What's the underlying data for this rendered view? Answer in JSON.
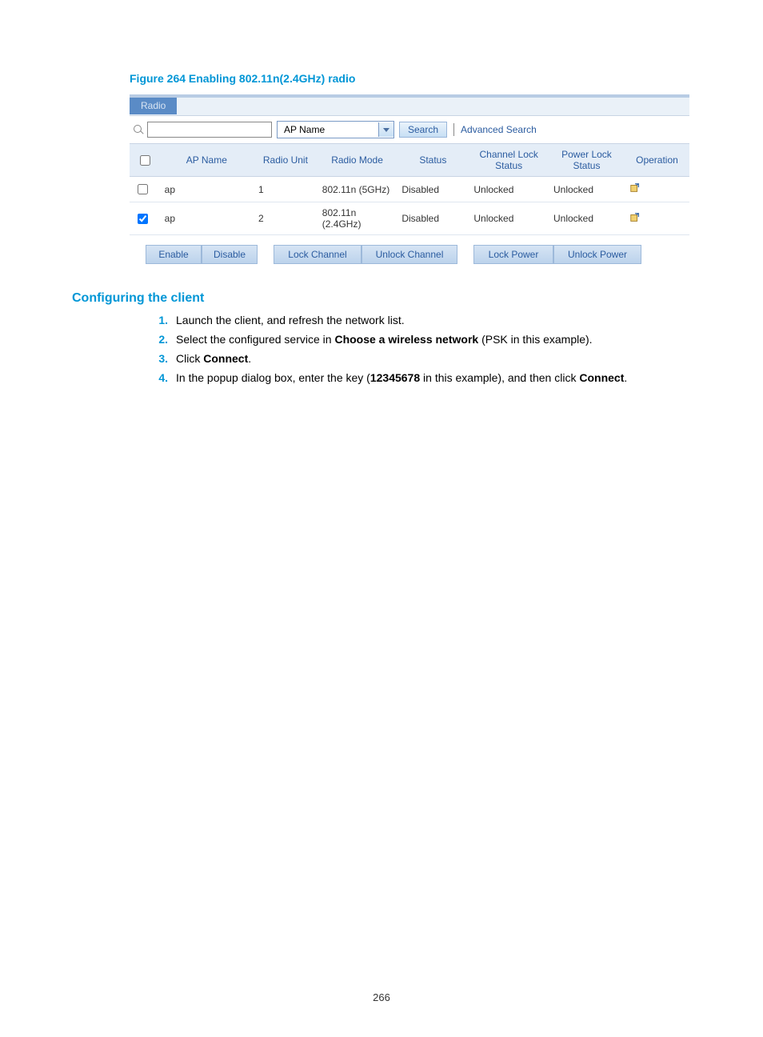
{
  "figure_caption": "Figure 264 Enabling 802.11n(2.4GHz) radio",
  "tab_label": "Radio",
  "search": {
    "input_value": "",
    "dropdown_selected": "AP Name",
    "search_btn": "Search",
    "advanced_link": "Advanced Search"
  },
  "table": {
    "headers": {
      "checkbox": "",
      "ap_name": "AP Name",
      "radio_unit": "Radio Unit",
      "radio_mode": "Radio Mode",
      "status": "Status",
      "channel_lock": "Channel Lock Status",
      "power_lock": "Power Lock Status",
      "operation": "Operation"
    },
    "rows": [
      {
        "checked": false,
        "ap_name": "ap",
        "radio_unit": "1",
        "radio_mode": "802.11n (5GHz)",
        "status": "Disabled",
        "channel_lock": "Unlocked",
        "power_lock": "Unlocked"
      },
      {
        "checked": true,
        "ap_name": "ap",
        "radio_unit": "2",
        "radio_mode": "802.11n (2.4GHz)",
        "status": "Disabled",
        "channel_lock": "Unlocked",
        "power_lock": "Unlocked"
      }
    ]
  },
  "actions": {
    "enable": "Enable",
    "disable": "Disable",
    "lock_channel": "Lock Channel",
    "unlock_channel": "Unlock Channel",
    "lock_power": "Lock Power",
    "unlock_power": "Unlock Power"
  },
  "section_heading": "Configuring the client",
  "steps": [
    {
      "n": "1.",
      "pre": "Launch the client, and refresh the network list."
    },
    {
      "n": "2.",
      "pre": "Select the configured service in ",
      "b1": "Choose a wireless network",
      "post": " (PSK in this example)."
    },
    {
      "n": "3.",
      "pre": "Click ",
      "b1": "Connect",
      "post": "."
    },
    {
      "n": "4.",
      "pre": "In the popup dialog box, enter the key (",
      "b1": "12345678",
      "mid": " in this example), and then click ",
      "b2": "Connect",
      "post": "."
    }
  ],
  "page_number": "266"
}
